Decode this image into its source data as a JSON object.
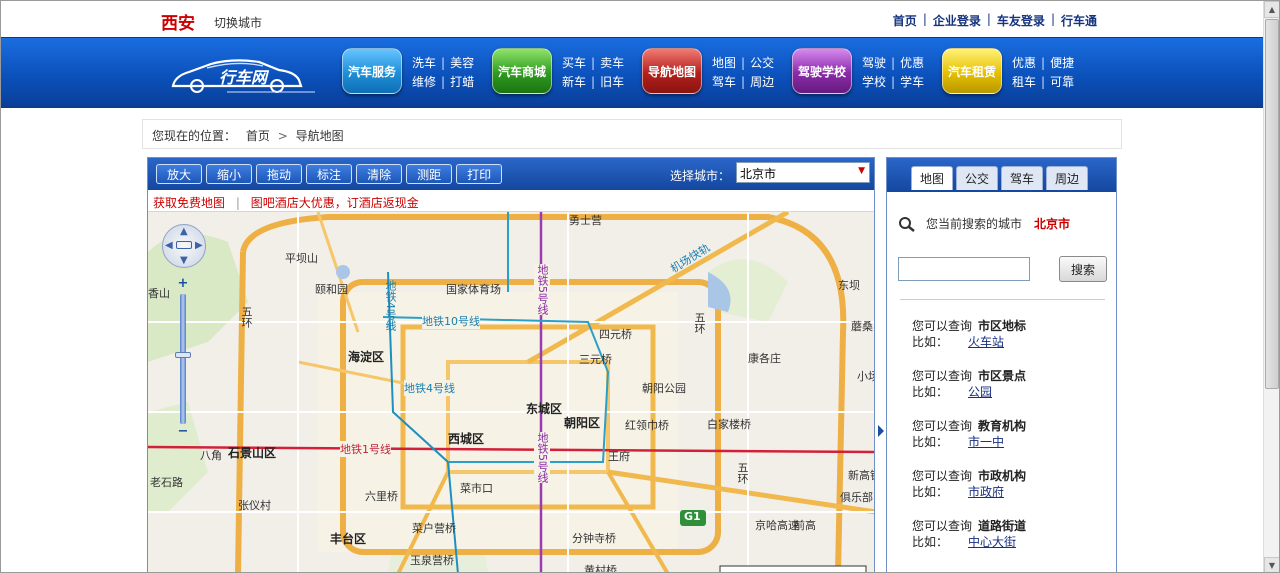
{
  "header": {
    "city": "西安",
    "switch_city": "切换城市",
    "links": [
      "首页",
      "企业登录",
      "车友登录",
      "行车通"
    ],
    "separator": "|"
  },
  "logo": {
    "text": "行车网"
  },
  "nav": {
    "groups": [
      {
        "button": "汽车服务",
        "color": "#1e8fd6",
        "links": [
          [
            "洗车",
            "美容"
          ],
          [
            "维修",
            "打蜡"
          ]
        ]
      },
      {
        "button": "汽车商城",
        "color": "#2e9b1f",
        "links": [
          [
            "买车",
            "卖车"
          ],
          [
            "新车",
            "旧车"
          ]
        ]
      },
      {
        "button": "导航地图",
        "color": "#b3201c",
        "links": [
          [
            "地图",
            "公交"
          ],
          [
            "驾车",
            "周边"
          ]
        ]
      },
      {
        "button": "驾驶学校",
        "color": "#8a2aa8",
        "links": [
          [
            "驾驶",
            "优惠"
          ],
          [
            "学校",
            "学车"
          ]
        ]
      },
      {
        "button": "汽车租赁",
        "color": "#e6c000",
        "links": [
          [
            "优惠",
            "便捷"
          ],
          [
            "租车",
            "可靠"
          ]
        ]
      }
    ]
  },
  "breadcrumb": {
    "label": "您现在的位置：",
    "items": [
      "首页",
      "导航地图"
    ],
    "arrow": ">"
  },
  "map": {
    "tools": [
      "放大",
      "缩小",
      "拖动",
      "标注",
      "清除",
      "测距",
      "打印"
    ],
    "select_label": "选择城市：",
    "selected_city": "北京市",
    "promo_left": "获取免费地图",
    "promo_sep": "|",
    "promo_right": "图吧酒店大优惠，订酒店返现金",
    "labels": {
      "l1": "勇士营",
      "l2": "颐和园",
      "l3": "国家体育场",
      "l4": "海淀区",
      "l5": "四元桥",
      "l6": "三元桥",
      "l7": "东城区",
      "l8": "朝阳区",
      "l9": "西城区",
      "l10": "石景山区",
      "l11": "丰台区",
      "l12": "红领巾桥",
      "l13": "朝阳公园",
      "l14": "康各庄",
      "l15": "六里桥",
      "l16": "菜户营桥",
      "l17": "分钟寺桥",
      "l18": "玉泉营桥",
      "l19": "京哈高速",
      "l20": "平坝山",
      "l21": "香山",
      "l22": "八角",
      "l23": "老石路",
      "l24": "张仪村",
      "l25": "菜市口",
      "l26": "白家楼桥",
      "l27": "王府",
      "l28": "蘑桑",
      "l29": "小场",
      "l30": "机场快轨",
      "l31": "五环",
      "l32": "五环",
      "l33": "五环",
      "l34": "G1",
      "l35": "新高铁",
      "l36": "俱乐部",
      "l37": "前高",
      "l38": "东坝",
      "l39": "黄村桥"
    },
    "subway": {
      "s1": "地铁4号线",
      "s2": "地铁10号线",
      "s3": "地铁5号线",
      "s4": "地铁4号线",
      "s5": "地铁1号线",
      "s6": "地铁5号线"
    },
    "pan_arrows": [
      "▲",
      "▼",
      "◀",
      "▶"
    ],
    "zoom_plus": "+",
    "zoom_minus": "−"
  },
  "panel": {
    "tabs": [
      "地图",
      "公交",
      "驾车",
      "周边"
    ],
    "current_label": "您当前搜索的城市",
    "current_city": "北京市",
    "search_button": "搜索",
    "search_value": "",
    "queries": [
      {
        "prefix": "您可以查询",
        "category": "市区地标",
        "ex_label": "比如：",
        "example": "火车站"
      },
      {
        "prefix": "您可以查询",
        "category": "市区景点",
        "ex_label": "比如：",
        "example": "公园"
      },
      {
        "prefix": "您可以查询",
        "category": "教育机构",
        "ex_label": "比如：",
        "example": "市一中"
      },
      {
        "prefix": "您可以查询",
        "category": "市政机构",
        "ex_label": "比如：",
        "example": "市政府"
      },
      {
        "prefix": "您可以查询",
        "category": "道路街道",
        "ex_label": "比如：",
        "example": "中心大街"
      }
    ]
  },
  "colors": {
    "nav_blue": "#0b4fb8",
    "accent_red": "#cc0000",
    "link_blue": "#16337f"
  }
}
